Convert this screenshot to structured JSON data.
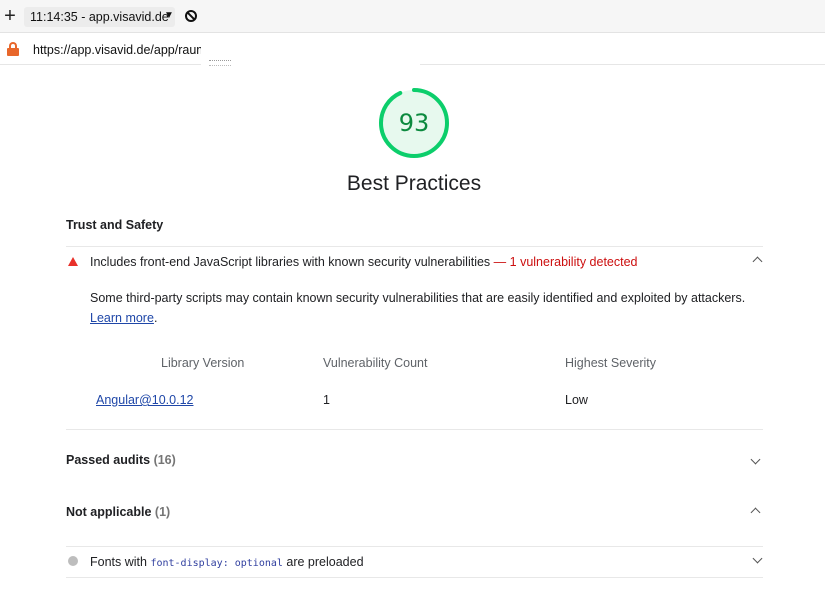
{
  "browser": {
    "tab_info": "11:14:35 - app.visavid.de",
    "url": "https://app.visavid.de/app/raum/"
  },
  "score": {
    "value": "93",
    "fraction": 0.93,
    "color": "#0cce6b"
  },
  "category_title": "Best Practices",
  "trust_group": {
    "title": "Trust and Safety"
  },
  "audit": {
    "title": "Includes front-end JavaScript libraries with known security vulnerabilities",
    "separator": "—",
    "display_value": "1 vulnerability detected",
    "description": "Some third-party scripts may contain known security vulnerabilities that are easily identified and exploited by attackers.",
    "learn_more": "Learn more",
    "learn_more_suffix": ".",
    "table": {
      "headers": [
        "Library Version",
        "Vulnerability Count",
        "Highest Severity"
      ],
      "rows": [
        {
          "library": "Angular@10.0.12",
          "count": "1",
          "severity": "Low"
        }
      ]
    }
  },
  "passed": {
    "label": "Passed audits",
    "count": "(16)"
  },
  "not_applicable": {
    "label": "Not applicable",
    "count": "(1)"
  },
  "na_audit": {
    "prefix": "Fonts with",
    "code": "font-display: optional",
    "suffix": "are preloaded"
  }
}
